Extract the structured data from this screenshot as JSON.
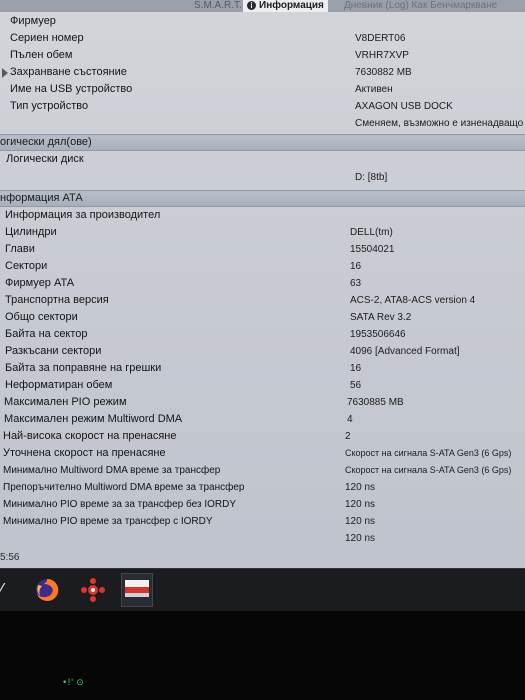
{
  "tabs": {
    "smart": "S.M.A.R.T.",
    "info": "Информация",
    "other": "Дневник (Log)  Как Бенчмаркване"
  },
  "device_rows": [
    {
      "label": "Фирмуер",
      "value": ""
    },
    {
      "label": "Сериен номер",
      "value": "V8DERT06"
    },
    {
      "label": "Пълен обем",
      "value": "VRHR7XVP"
    },
    {
      "label": "Захранване състояние",
      "value": "7630882 MB"
    },
    {
      "label": "Име на USB устройство",
      "value": "Активен"
    },
    {
      "label": "Тип устройство",
      "value": "AXAGON USB DOCK"
    },
    {
      "label": "",
      "value": "Сменяем, възможно е изненадващо п"
    }
  ],
  "logical_section": "огически дял(ове)",
  "logical_rows": [
    {
      "label": "Логически диск",
      "value": ""
    },
    {
      "label": "",
      "value": "D: [8tb]"
    }
  ],
  "ata_section": "нформация АТА",
  "ata_rows": [
    {
      "label": "Информация за производител",
      "value": ""
    },
    {
      "label": "Цилиндри",
      "value": "DELL(tm)"
    },
    {
      "label": "Глави",
      "value": "15504021"
    },
    {
      "label": "Сектори",
      "value": "16"
    },
    {
      "label": "Фирмуер АТА",
      "value": "63"
    },
    {
      "label": "Транспортна версия",
      "value": "ACS-2, ATA8-ACS version 4"
    },
    {
      "label": "Общо сектори",
      "value": "SATA Rev 3.2"
    },
    {
      "label": "Байта на сектор",
      "value": "1953506646"
    },
    {
      "label": "Разкъсани сектори",
      "value": "4096 [Advanced Format]"
    },
    {
      "label": "Байта за поправяне на грешки",
      "value": "16"
    },
    {
      "label": "Неформатиран обем",
      "value": "56"
    },
    {
      "label": "Максимален PIO режим",
      "value": "7630885 MB"
    },
    {
      "label": "Максимален режим Multiword DMA",
      "value": "4"
    },
    {
      "label": "Най-висока скорост на пренасяне",
      "value": "2"
    },
    {
      "label": "Уточнена скорост на пренасяне",
      "value": "Скорост на сигнала S-ATA Gen3 (6 Gps)"
    },
    {
      "label": "Минимално Multiword DMA време за трансфер",
      "value": "Скорост на сигнала S-ATA Gen3 (6 Gps)"
    },
    {
      "label": "Препоръчително Multiword DMA време за трансфер",
      "value": "120 ns"
    },
    {
      "label": "Минимално PIO време за за трансфер без IORDY",
      "value": "120 ns"
    },
    {
      "label": "Минимално PIO време за трансфер с IORDY",
      "value": "120 ns"
    },
    {
      "label": "",
      "value": "120 ns"
    }
  ],
  "clock": "5:56",
  "taskbar": {
    "start_glyph": "⁄",
    "items": [
      "firefox-icon",
      "app-icon",
      "window-thumbnail"
    ]
  },
  "led": "•!' ⊙"
}
